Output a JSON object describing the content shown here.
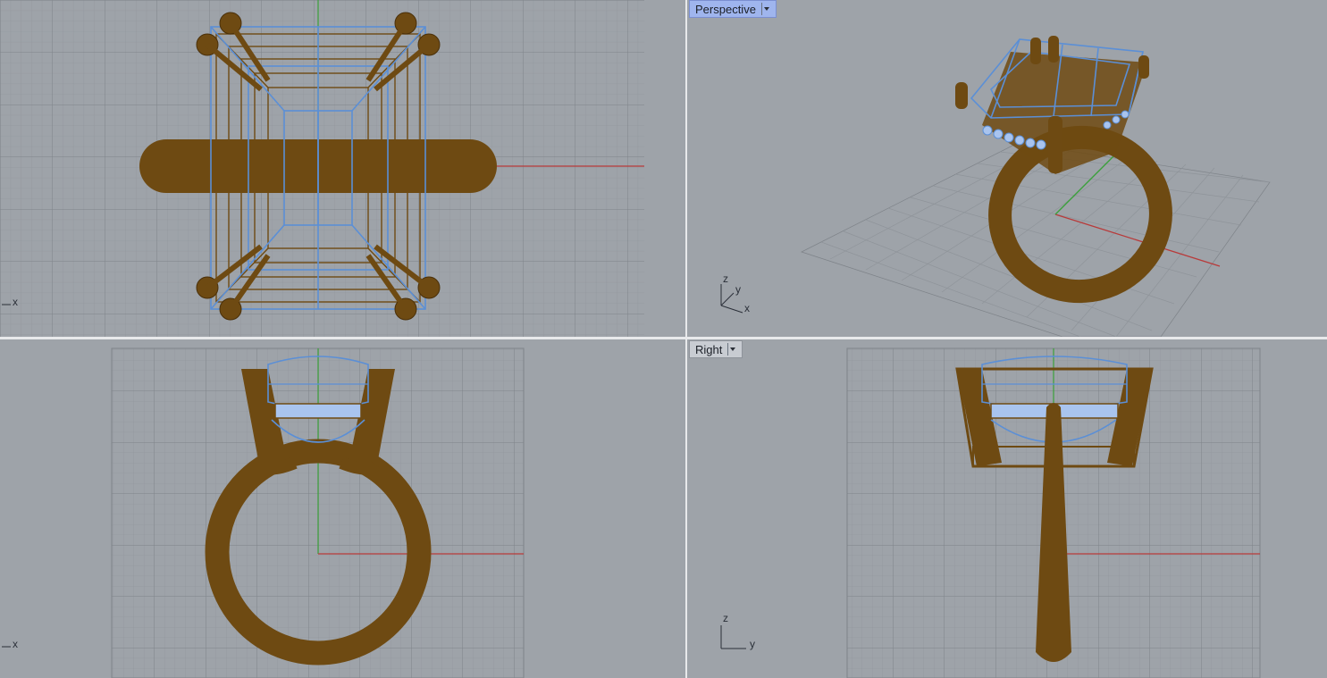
{
  "viewports": {
    "top": {
      "axis_x": "x"
    },
    "perspective": {
      "label": "Perspective",
      "axis_x": "x",
      "axis_y": "y",
      "axis_z": "z"
    },
    "front": {
      "axis_x": "x"
    },
    "right": {
      "label": "Right",
      "axis_y": "y",
      "axis_z": "z"
    }
  },
  "colors": {
    "viewport_bg": "#9ea3a9",
    "grid_minor": "#8f949a",
    "grid_major": "#7e8389",
    "metal": "#6e4a12",
    "gem_wire": "#5b8fd6",
    "x_axis": "#b83a3a",
    "y_axis": "#3aa03a",
    "active_label": "#9fb5ee"
  }
}
